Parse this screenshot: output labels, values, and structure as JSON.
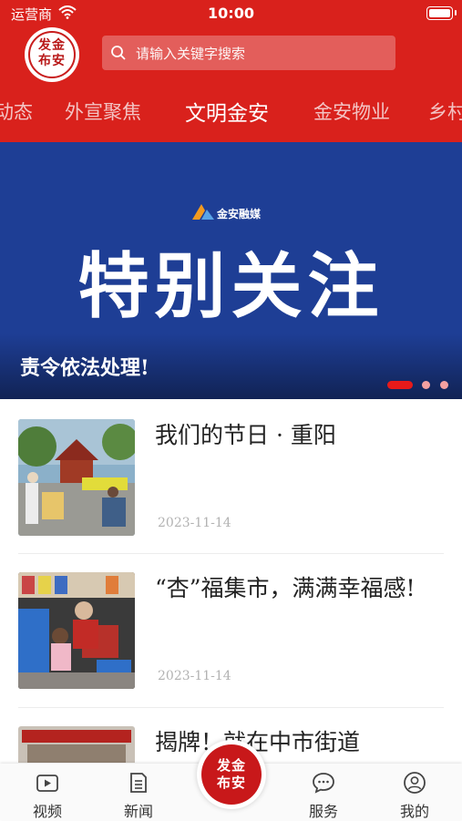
{
  "status_bar": {
    "carrier": "运营商",
    "time": "10:00"
  },
  "header": {
    "logo_line1": "发金",
    "logo_line2": "布安",
    "search_placeholder": "请输入关键字搜索"
  },
  "channel_tabs": [
    {
      "label": "动态",
      "active": false
    },
    {
      "label": "外宣聚焦",
      "active": false
    },
    {
      "label": "文明金安",
      "active": true
    },
    {
      "label": "金安物业",
      "active": false
    },
    {
      "label": "乡村",
      "active": false
    }
  ],
  "banner": {
    "brand": "金安融媒",
    "headline": "特别关注",
    "caption": "责令依法处理!",
    "slide_count": 3,
    "active_slide": 0
  },
  "news": [
    {
      "title": "我们的节日 · 重阳",
      "date": "2023-11-14"
    },
    {
      "title": "“杏”福集市，满满幸福感!",
      "date": "2023-11-14"
    },
    {
      "title": "揭牌！就在中市街道",
      "date": ""
    }
  ],
  "tabbar": {
    "video": "视频",
    "news": "新闻",
    "center_line1": "发金",
    "center_line2": "布安",
    "service": "服务",
    "mine": "我的"
  },
  "colors": {
    "brand_red": "#d9211c",
    "banner_blue": "#1e3e95"
  }
}
